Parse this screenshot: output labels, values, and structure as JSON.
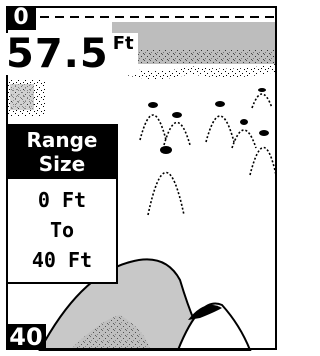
{
  "sonar": {
    "top_scale": "0",
    "bottom_scale": "40",
    "depth_value": "57.5",
    "depth_unit": "Ft"
  },
  "range_menu": {
    "title_line1": "Range",
    "title_line2": "Size",
    "lower_value": "0 Ft",
    "separator": "To",
    "upper_value": "40 Ft"
  },
  "colors": {
    "background": "#ffffff",
    "foreground": "#000000",
    "bottom_fill": "#c8c8c8",
    "surface_band": "#bdbdbd"
  }
}
